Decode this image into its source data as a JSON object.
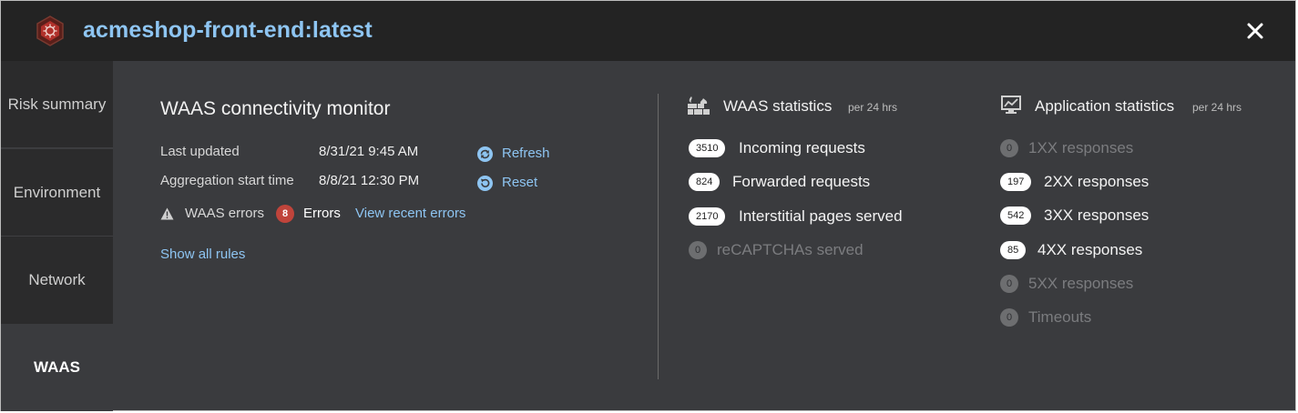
{
  "header": {
    "title": "acmeshop-front-end:latest",
    "logo_icon": "hexagon-helm-logo",
    "close_icon": "close-icon"
  },
  "sidebar": {
    "items": [
      {
        "label": "Risk summary"
      },
      {
        "label": "Environment"
      },
      {
        "label": "Network"
      },
      {
        "label": "WAAS",
        "active": true
      }
    ]
  },
  "monitor": {
    "title": "WAAS connectivity monitor",
    "last_updated_label": "Last updated",
    "last_updated_value": "8/31/21 9:45 AM",
    "refresh_label": "Refresh",
    "aggregation_label": "Aggregation start time",
    "aggregation_value": "8/8/21 12:30 PM",
    "reset_label": "Reset",
    "errors_label": "WAAS errors",
    "errors_count": "8",
    "errors_text": "Errors",
    "view_errors_label": "View recent errors",
    "show_rules_label": "Show all rules"
  },
  "waas_stats": {
    "title": "WAAS statistics",
    "period": "per 24 hrs",
    "items": [
      {
        "count": "3510",
        "label": "Incoming requests",
        "muted": false
      },
      {
        "count": "824",
        "label": "Forwarded requests",
        "muted": false
      },
      {
        "count": "2170",
        "label": "Interstitial pages served",
        "muted": false
      },
      {
        "count": "0",
        "label": "reCAPTCHAs served",
        "muted": true
      }
    ]
  },
  "app_stats": {
    "title": "Application statistics",
    "period": "per 24 hrs",
    "items": [
      {
        "count": "0",
        "label": "1XX responses",
        "muted": true
      },
      {
        "count": "197",
        "label": "2XX responses",
        "muted": false
      },
      {
        "count": "542",
        "label": "3XX responses",
        "muted": false
      },
      {
        "count": "85",
        "label": "4XX responses",
        "muted": false
      },
      {
        "count": "0",
        "label": "5XX responses",
        "muted": true
      },
      {
        "count": "0",
        "label": "Timeouts",
        "muted": true
      }
    ]
  },
  "colors": {
    "accent_link": "#8ec5f2",
    "error_badge": "#c0443b",
    "header_bg": "#232323",
    "panel_bg": "#3a3b3e"
  }
}
